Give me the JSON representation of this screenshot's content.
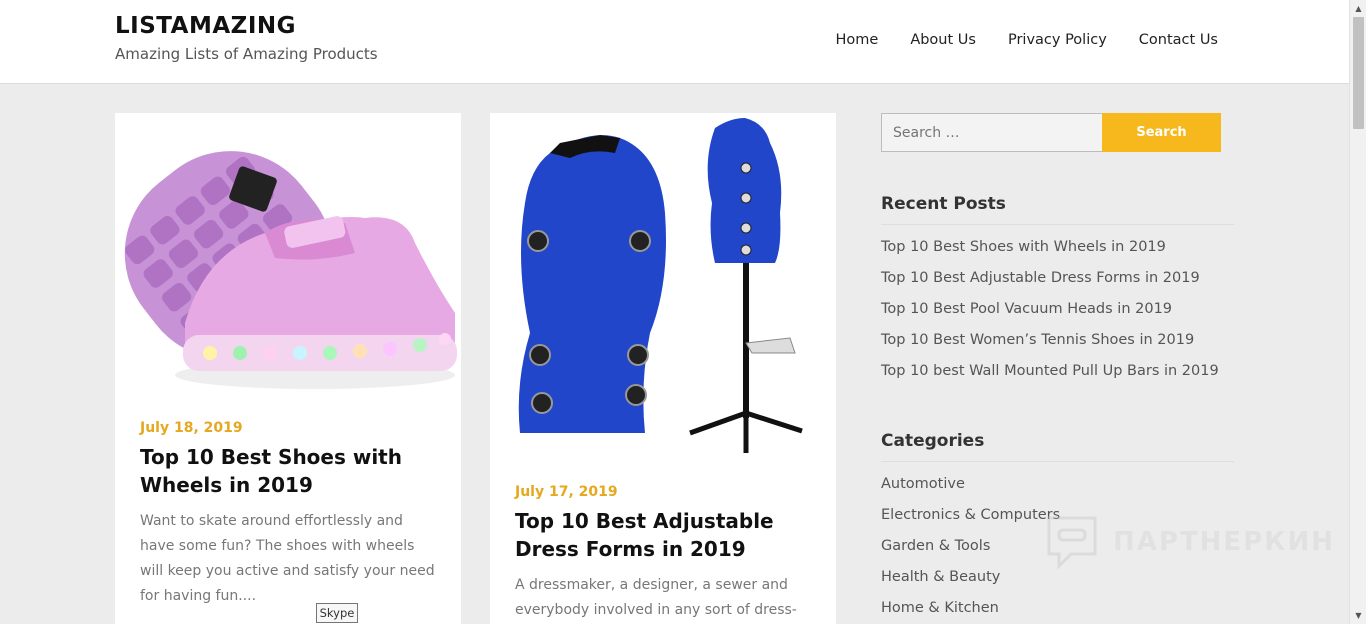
{
  "header": {
    "site_title": "LISTAMAZING",
    "tagline": "Amazing Lists of Amazing Products",
    "nav": [
      "Home",
      "About Us",
      "Privacy Policy",
      "Contact Us"
    ]
  },
  "posts": [
    {
      "date": "July 18, 2019",
      "title": "Top 10 Best Shoes with Wheels in 2019",
      "excerpt": "Want to skate around effortlessly and have some fun? The shoes with wheels will keep you active and satisfy your need for having fun...."
    },
    {
      "date": "July 17, 2019",
      "title": "Top 10 Best Adjustable Dress Forms in 2019",
      "excerpt": "A dressmaker, a designer, a sewer and everybody involved in any sort of dress-"
    }
  ],
  "sidebar": {
    "search": {
      "placeholder": "Search …",
      "button": "Search"
    },
    "recent_posts": {
      "title": "Recent Posts",
      "items": [
        "Top 10 Best Shoes with Wheels in 2019",
        "Top 10 Best Adjustable Dress Forms in 2019",
        "Top 10 Best Pool Vacuum Heads in 2019",
        "Top 10 Best Women’s Tennis Shoes in 2019",
        "Top 10 best Wall Mounted Pull Up Bars in 2019"
      ]
    },
    "categories": {
      "title": "Categories",
      "items": [
        "Automotive",
        "Electronics & Computers",
        "Garden & Tools",
        "Health & Beauty",
        "Home & Kitchen"
      ]
    }
  },
  "watermark": "ПАРТНЕРКИН",
  "tooltip": "Skype",
  "colors": {
    "accent": "#f6b81c",
    "date": "#e5a81e"
  }
}
